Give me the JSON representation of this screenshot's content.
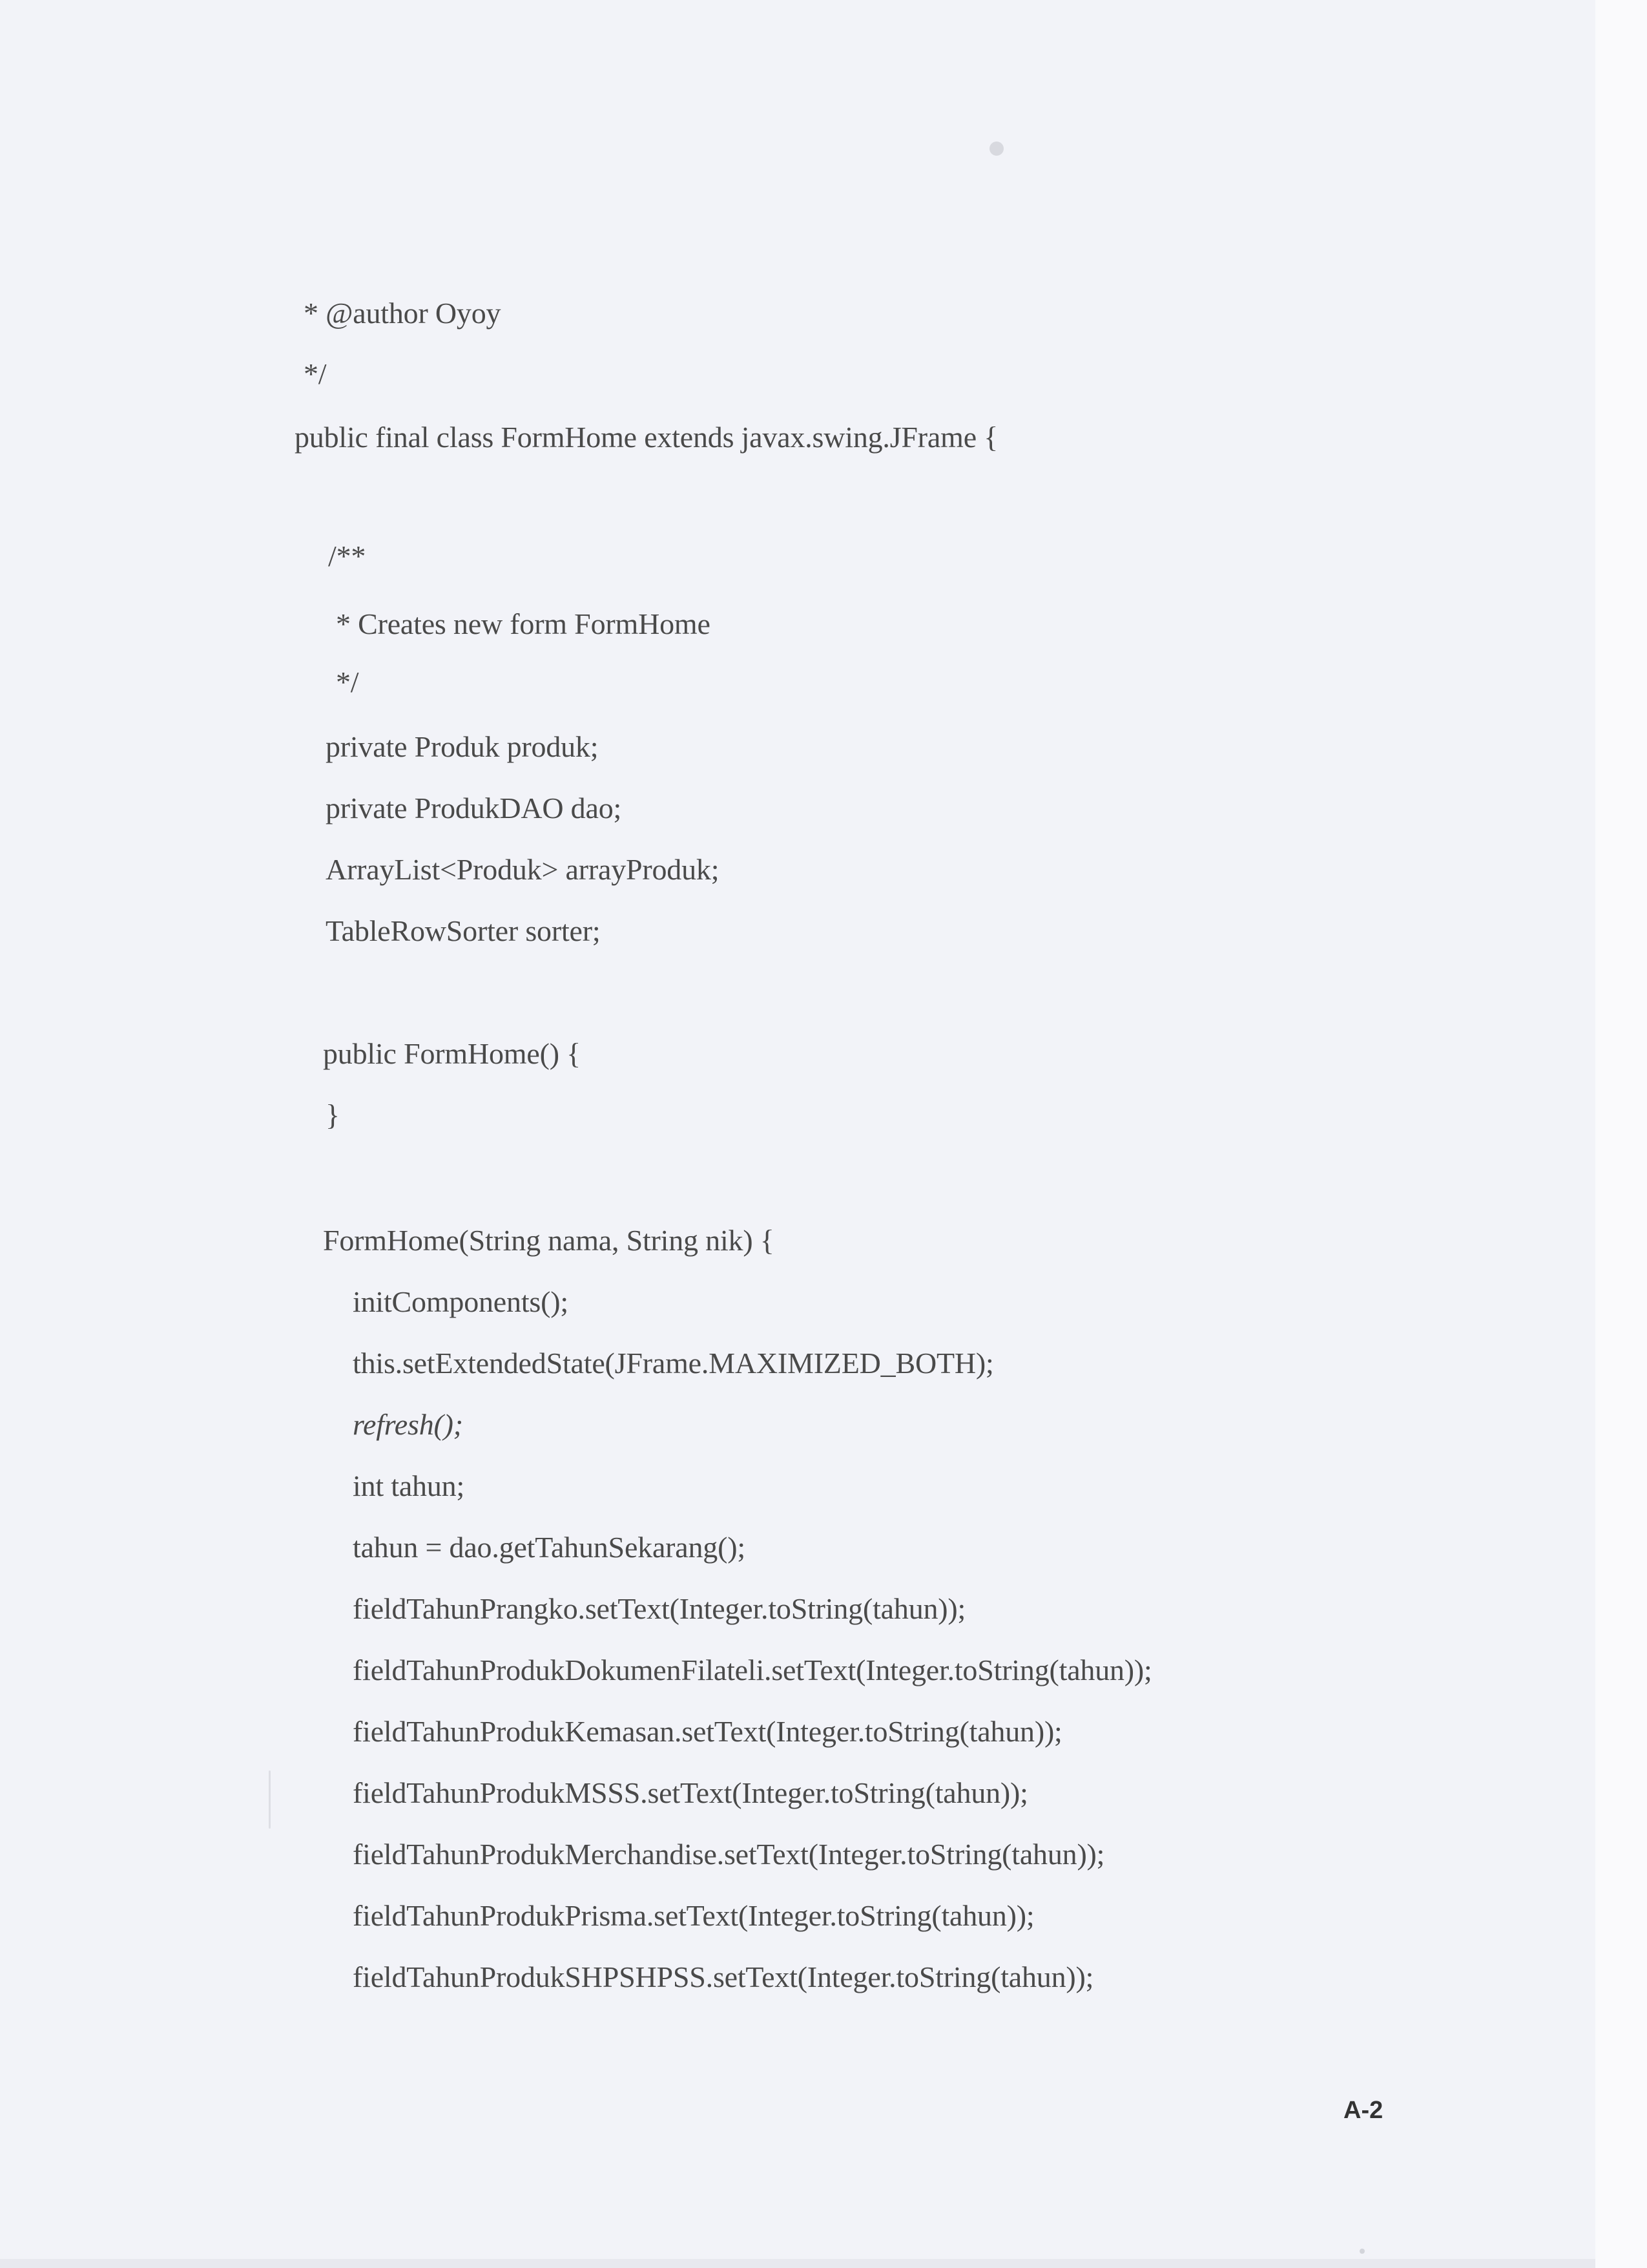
{
  "code_lines": [
    "* @author Oyoy",
    "*/",
    "public final class FormHome extends javax.swing.JFrame {",
    "/**",
    "* Creates new form FormHome",
    "*/",
    "private Produk produk;",
    "private ProdukDAO dao;",
    "ArrayList<Produk> arrayProduk;",
    "TableRowSorter sorter;",
    "public FormHome() {",
    "}",
    "FormHome(String nama, String nik) {",
    "initComponents();",
    "this.setExtendedState(JFrame.MAXIMIZED_BOTH);",
    "refresh();",
    "int tahun;",
    "tahun = dao.getTahunSekarang();",
    "fieldTahunPrangko.setText(Integer.toString(tahun));",
    "fieldTahunProdukDokumenFilateli.setText(Integer.toString(tahun));",
    "fieldTahunProdukKemasan.setText(Integer.toString(tahun));",
    "fieldTahunProdukMSSS.setText(Integer.toString(tahun));",
    "fieldTahunProdukMerchandise.setText(Integer.toString(tahun));",
    "fieldTahunProdukPrisma.setText(Integer.toString(tahun));",
    "fieldTahunProdukSHPSHPSS.setText(Integer.toString(tahun));"
  ],
  "page_number": "A-2"
}
